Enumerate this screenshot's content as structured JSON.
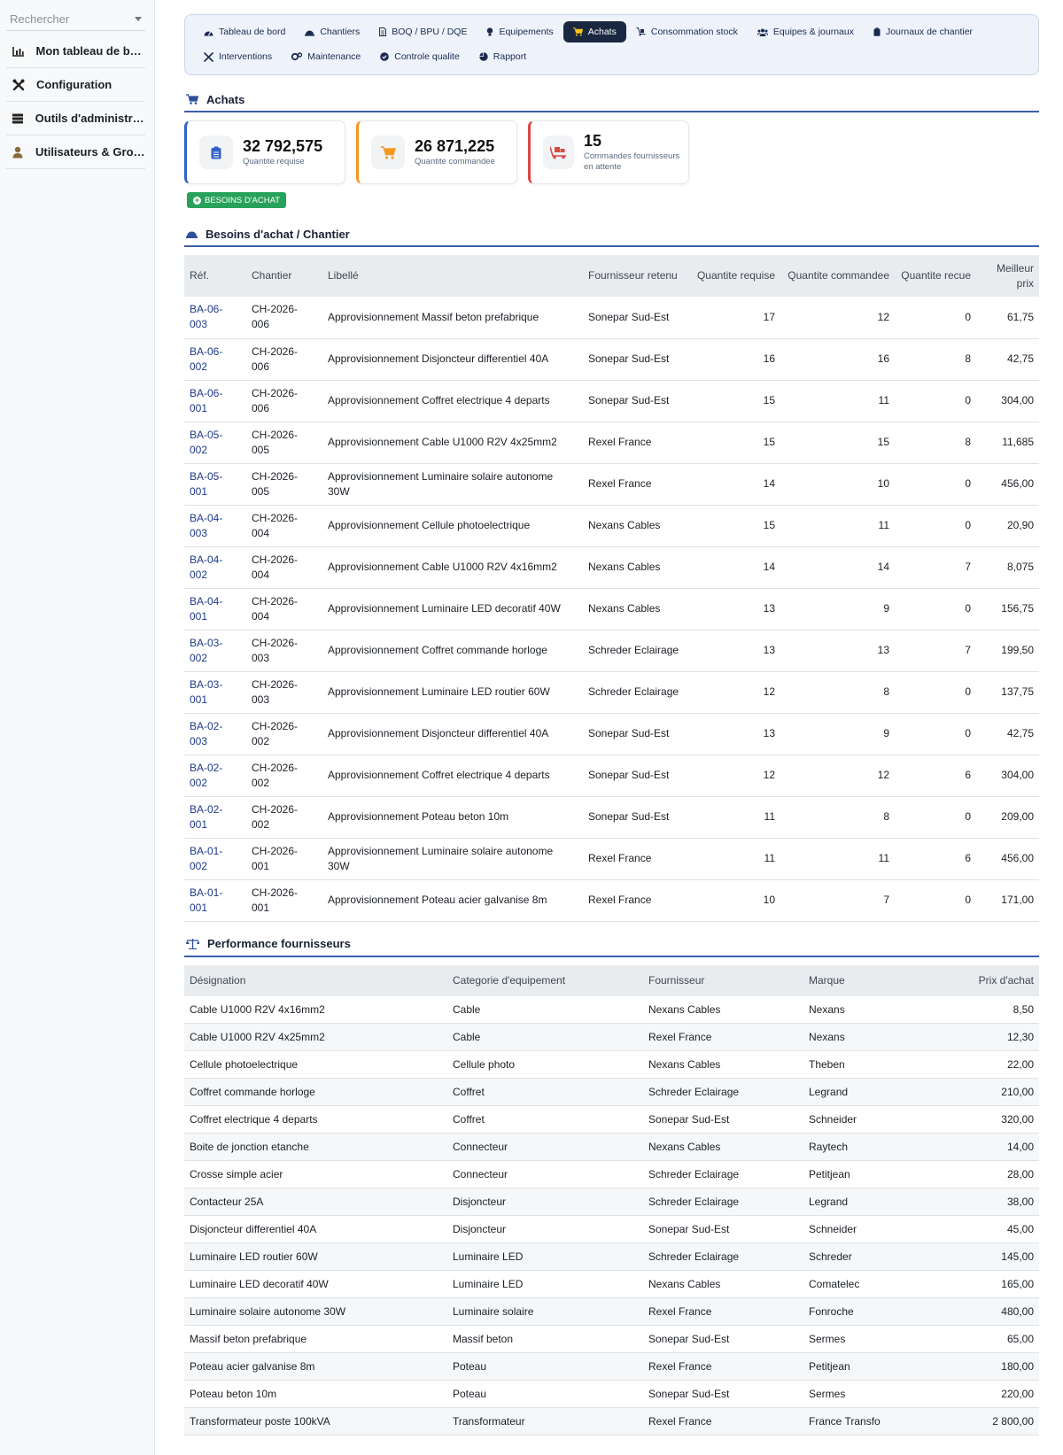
{
  "sidebar": {
    "search_placeholder": "Rechercher",
    "items": [
      {
        "label": "Mon tableau de bord",
        "icon": "bar-chart-icon"
      },
      {
        "label": "Configuration",
        "icon": "tools-icon"
      },
      {
        "label": "Outils d'administrat…",
        "icon": "server-icon"
      },
      {
        "label": "Utilisateurs & Grou…",
        "icon": "user-icon"
      }
    ]
  },
  "nav": {
    "tabs": [
      {
        "label": "Tableau de bord",
        "icon": "dashboard-icon",
        "active": false
      },
      {
        "label": "Chantiers",
        "icon": "helmet-icon",
        "active": false
      },
      {
        "label": "BOQ / BPU / DQE",
        "icon": "file-icon",
        "active": false
      },
      {
        "label": "Equipements",
        "icon": "lightbulb-icon",
        "active": false
      },
      {
        "label": "Achats",
        "icon": "cart-icon",
        "active": true
      },
      {
        "label": "Consommation stock",
        "icon": "dolly-icon",
        "active": false
      },
      {
        "label": "Equipes & journaux",
        "icon": "users-icon",
        "active": false
      },
      {
        "label": "Journaux de chantier",
        "icon": "clipboard-icon",
        "active": false
      },
      {
        "label": "Interventions",
        "icon": "wrench-icon",
        "active": false
      },
      {
        "label": "Maintenance",
        "icon": "cogs-icon",
        "active": false
      },
      {
        "label": "Controle qualite",
        "icon": "check-circle-icon",
        "active": false
      },
      {
        "label": "Rapport",
        "icon": "pie-chart-icon",
        "active": false
      }
    ]
  },
  "achats": {
    "title": "Achats",
    "cards": [
      {
        "value": "32 792,575",
        "label": "Quantite requise",
        "color": "#2f62c7",
        "icon": "clipboard-list-icon"
      },
      {
        "value": "26 871,225",
        "label": "Quantite commandee",
        "color": "#f2981e",
        "icon": "cart-icon"
      },
      {
        "value": "15",
        "label": "Commandes fournisseurs en attente",
        "color": "#d84a42",
        "icon": "truck-loading-icon"
      }
    ],
    "badge": "BESOINS D'ACHAT"
  },
  "besoins": {
    "title": "Besoins d'achat / Chantier",
    "headers": [
      "Réf.",
      "Chantier",
      "Libellé",
      "Fournisseur retenu",
      "Quantite requise",
      "Quantite commandee",
      "Quantite recue",
      "Meilleur prix"
    ],
    "rows": [
      [
        "BA-06-003",
        "CH-2026-006",
        "Approvisionnement Massif beton prefabrique",
        "Sonepar Sud-Est",
        "17",
        "12",
        "0",
        "61,75"
      ],
      [
        "BA-06-002",
        "CH-2026-006",
        "Approvisionnement Disjoncteur differentiel 40A",
        "Sonepar Sud-Est",
        "16",
        "16",
        "8",
        "42,75"
      ],
      [
        "BA-06-001",
        "CH-2026-006",
        "Approvisionnement Coffret electrique 4 departs",
        "Sonepar Sud-Est",
        "15",
        "11",
        "0",
        "304,00"
      ],
      [
        "BA-05-002",
        "CH-2026-005",
        "Approvisionnement Cable U1000 R2V 4x25mm2",
        "Rexel France",
        "15",
        "15",
        "8",
        "11,685"
      ],
      [
        "BA-05-001",
        "CH-2026-005",
        "Approvisionnement Luminaire solaire autonome 30W",
        "Rexel France",
        "14",
        "10",
        "0",
        "456,00"
      ],
      [
        "BA-04-003",
        "CH-2026-004",
        "Approvisionnement Cellule photoelectrique",
        "Nexans Cables",
        "15",
        "11",
        "0",
        "20,90"
      ],
      [
        "BA-04-002",
        "CH-2026-004",
        "Approvisionnement Cable U1000 R2V 4x16mm2",
        "Nexans Cables",
        "14",
        "14",
        "7",
        "8,075"
      ],
      [
        "BA-04-001",
        "CH-2026-004",
        "Approvisionnement Luminaire LED decoratif 40W",
        "Nexans Cables",
        "13",
        "9",
        "0",
        "156,75"
      ],
      [
        "BA-03-002",
        "CH-2026-003",
        "Approvisionnement Coffret commande horloge",
        "Schreder Eclairage",
        "13",
        "13",
        "7",
        "199,50"
      ],
      [
        "BA-03-001",
        "CH-2026-003",
        "Approvisionnement Luminaire LED routier 60W",
        "Schreder Eclairage",
        "12",
        "8",
        "0",
        "137,75"
      ],
      [
        "BA-02-003",
        "CH-2026-002",
        "Approvisionnement Disjoncteur differentiel 40A",
        "Sonepar Sud-Est",
        "13",
        "9",
        "0",
        "42,75"
      ],
      [
        "BA-02-002",
        "CH-2026-002",
        "Approvisionnement Coffret electrique 4 departs",
        "Sonepar Sud-Est",
        "12",
        "12",
        "6",
        "304,00"
      ],
      [
        "BA-02-001",
        "CH-2026-002",
        "Approvisionnement Poteau beton 10m",
        "Sonepar Sud-Est",
        "11",
        "8",
        "0",
        "209,00"
      ],
      [
        "BA-01-002",
        "CH-2026-001",
        "Approvisionnement Luminaire solaire autonome 30W",
        "Rexel France",
        "11",
        "11",
        "6",
        "456,00"
      ],
      [
        "BA-01-001",
        "CH-2026-001",
        "Approvisionnement Poteau acier galvanise 8m",
        "Rexel France",
        "10",
        "7",
        "0",
        "171,00"
      ]
    ]
  },
  "performance": {
    "title": "Performance fournisseurs",
    "headers": [
      "Désignation",
      "Categorie d'equipement",
      "Fournisseur",
      "Marque",
      "Prix d'achat"
    ],
    "rows": [
      [
        "Cable U1000 R2V 4x16mm2",
        "Cable",
        "Nexans Cables",
        "Nexans",
        "8,50"
      ],
      [
        "Cable U1000 R2V 4x25mm2",
        "Cable",
        "Rexel France",
        "Nexans",
        "12,30"
      ],
      [
        "Cellule photoelectrique",
        "Cellule photo",
        "Nexans Cables",
        "Theben",
        "22,00"
      ],
      [
        "Coffret commande horloge",
        "Coffret",
        "Schreder Eclairage",
        "Legrand",
        "210,00"
      ],
      [
        "Coffret electrique 4 departs",
        "Coffret",
        "Sonepar Sud-Est",
        "Schneider",
        "320,00"
      ],
      [
        "Boite de jonction etanche",
        "Connecteur",
        "Nexans Cables",
        "Raytech",
        "14,00"
      ],
      [
        "Crosse simple acier",
        "Connecteur",
        "Schreder Eclairage",
        "Petitjean",
        "28,00"
      ],
      [
        "Contacteur 25A",
        "Disjoncteur",
        "Schreder Eclairage",
        "Legrand",
        "38,00"
      ],
      [
        "Disjoncteur differentiel 40A",
        "Disjoncteur",
        "Sonepar Sud-Est",
        "Schneider",
        "45,00"
      ],
      [
        "Luminaire LED routier 60W",
        "Luminaire LED",
        "Schreder Eclairage",
        "Schreder",
        "145,00"
      ],
      [
        "Luminaire LED decoratif 40W",
        "Luminaire LED",
        "Nexans Cables",
        "Comatelec",
        "165,00"
      ],
      [
        "Luminaire solaire autonome 30W",
        "Luminaire solaire",
        "Rexel France",
        "Fonroche",
        "480,00"
      ],
      [
        "Massif beton prefabrique",
        "Massif beton",
        "Sonepar Sud-Est",
        "Sermes",
        "65,00"
      ],
      [
        "Poteau acier galvanise 8m",
        "Poteau",
        "Rexel France",
        "Petitjean",
        "180,00"
      ],
      [
        "Poteau beton 10m",
        "Poteau",
        "Sonepar Sud-Est",
        "Sermes",
        "220,00"
      ],
      [
        "Transformateur poste 100kVA",
        "Transformateur",
        "Rexel France",
        "France Transfo",
        "2 800,00"
      ]
    ]
  }
}
